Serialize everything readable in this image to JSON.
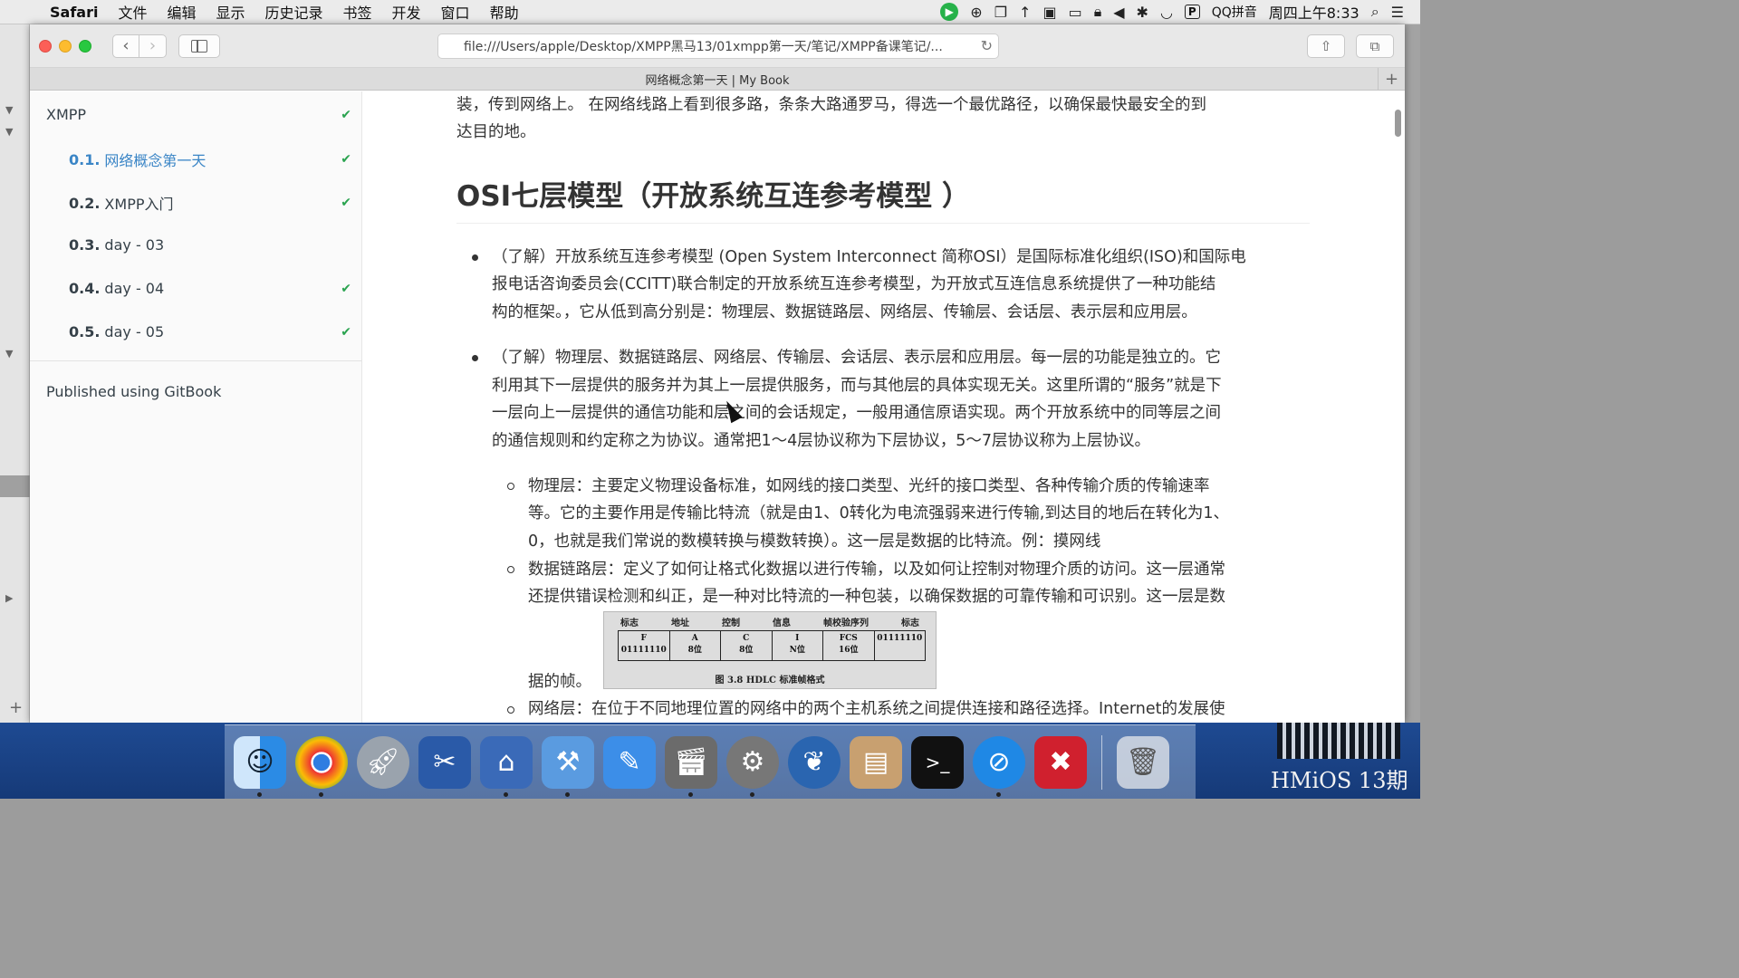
{
  "menubar": {
    "app_name": "Safari",
    "menus": [
      "文件",
      "编辑",
      "显示",
      "历史记录",
      "书签",
      "开发",
      "窗口",
      "帮助"
    ],
    "input_method": "QQ拼音",
    "clock": "周四上午8:33"
  },
  "browser": {
    "url": "file:///Users/apple/Desktop/XMPP黑马13/01xmpp第一天/笔记/XMPP备课笔记/...",
    "tab_title": "网络概念第一天 | My Book"
  },
  "gitbook": {
    "book_title": "XMPP",
    "chapters": [
      {
        "num": "0.1.",
        "title": "网络概念第一天",
        "checked": true,
        "active": true
      },
      {
        "num": "0.2.",
        "title": "XMPP入门",
        "checked": true,
        "active": false
      },
      {
        "num": "0.3.",
        "title": "day - 03",
        "checked": false,
        "active": false
      },
      {
        "num": "0.4.",
        "title": "day - 04",
        "checked": true,
        "active": false
      },
      {
        "num": "0.5.",
        "title": "day - 05",
        "checked": true,
        "active": false
      }
    ],
    "published": "Published using GitBook"
  },
  "content": {
    "intro_line1": "装，传到网络上。 在网络线路上看到很多路，条条大路通罗马，得选一个最优路径，以确保最快最安全的到",
    "intro_line2": "达目的地。",
    "heading": "OSI七层模型（开放系统互连参考模型 ）",
    "bullet1": [
      "（了解）开放系统互连参考模型 (Open System Interconnect 简称OSI）是国际标准化组织(ISO)和国际电",
      "报电话咨询委员会(CCITT)联合制定的开放系统互连参考模型，为开放式互连信息系统提供了一种功能结",
      "构的框架。，它从低到高分别是：物理层、数据链路层、网络层、传输层、会话层、表示层和应用层。"
    ],
    "bullet2": [
      "（了解）物理层、数据链路层、网络层、传输层、会话层、表示层和应用层。每一层的功能是独立的。它",
      "利用其下一层提供的服务并为其上一层提供服务，而与其他层的具体实现无关。这里所谓的“服务”就是下",
      "一层向上一层提供的通信功能和层之间的会话规定，一般用通信原语实现。两个开放系统中的同等层之间",
      "的通信规则和约定称之为协议。通常把1～4层协议称为下层协议，5～7层协议称为上层协议。"
    ],
    "sub1": [
      "物理层：主要定义物理设备标准，如网线的接口类型、光纤的接口类型、各种传输介质的传输速率",
      "等。它的主要作用是传输比特流（就是由1、0转化为电流强弱来进行传输,到达目的地后在转化为1、",
      "0，也就是我们常说的数模转换与模数转换）。这一层是数据的比特流。例：摸网线"
    ],
    "sub2": [
      "数据链路层：定义了如何让格式化数据以进行传输，以及如何让控制对物理介质的访问。这一层通常",
      "还提供错误检测和纠正，是一种对比特流的一种包装，以确保数据的可靠传输和可识别。这一层是数",
      "据的帧。"
    ],
    "sub3": "网络层：在位于不同地理位置的网络中的两个主机系统之间提供连接和路径选择。Internet的发展使",
    "hdlc_figure": {
      "headers": [
        "标志",
        "地址",
        "控制",
        "信息",
        "帧校验序列",
        "标志"
      ],
      "cells": [
        [
          "F",
          "01111110"
        ],
        [
          "A",
          "8位"
        ],
        [
          "C",
          "8位"
        ],
        [
          "I",
          "N位"
        ],
        [
          "FCS",
          "16位"
        ],
        [
          "",
          "01111110"
        ]
      ],
      "caption": "图 3.8  HDLC 标准帧格式"
    }
  },
  "watermark": "HMiOS 13期"
}
